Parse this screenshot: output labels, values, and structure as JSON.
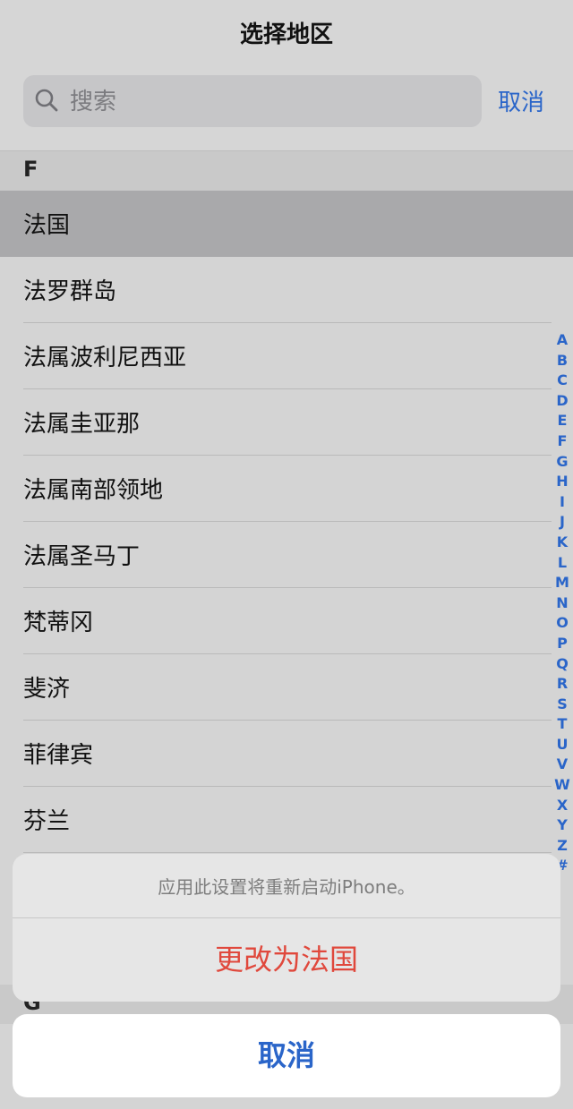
{
  "header": {
    "title": "选择地区",
    "search_placeholder": "搜索",
    "cancel_label": "取消"
  },
  "sections": {
    "f_letter": "F",
    "g_letter": "G"
  },
  "countries": [
    "法国",
    "法罗群岛",
    "法属波利尼西亚",
    "法属圭亚那",
    "法属南部领地",
    "法属圣马丁",
    "梵蒂冈",
    "斐济",
    "菲律宾",
    "芬兰"
  ],
  "selected_index": 0,
  "index_letters": [
    "A",
    "B",
    "C",
    "D",
    "E",
    "F",
    "G",
    "H",
    "I",
    "J",
    "K",
    "L",
    "M",
    "N",
    "O",
    "P",
    "Q",
    "R",
    "S",
    "T",
    "U",
    "V",
    "W",
    "X",
    "Y",
    "Z",
    "#"
  ],
  "action_sheet": {
    "message": "应用此设置将重新启动iPhone。",
    "confirm_label": "更改为法国",
    "cancel_label": "取消"
  },
  "colors": {
    "accent_blue": "#2a65c9",
    "destructive_red": "#e0483c"
  }
}
